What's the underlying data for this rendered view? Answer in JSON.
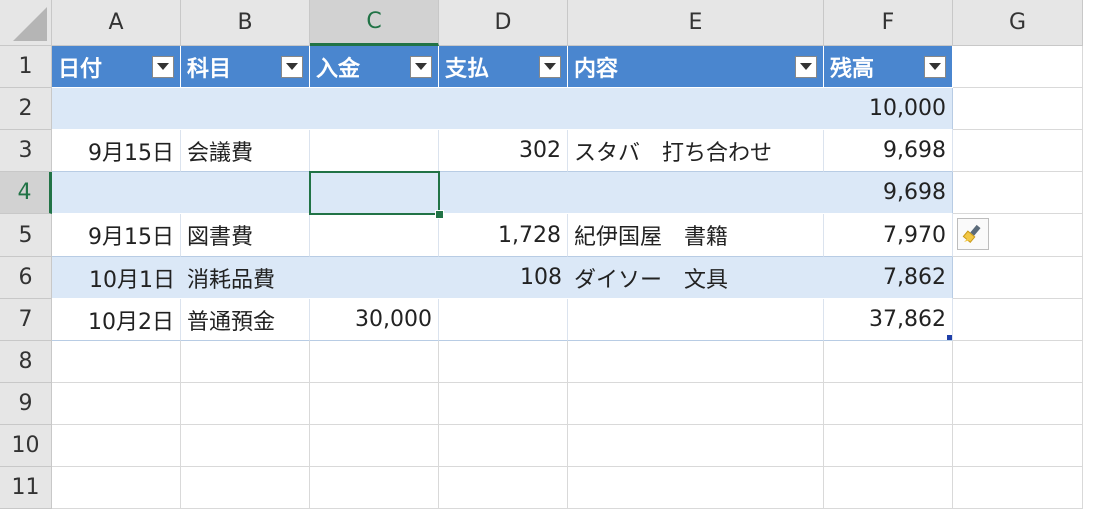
{
  "columns": [
    "A",
    "B",
    "C",
    "D",
    "E",
    "F",
    "G"
  ],
  "rows": [
    "1",
    "2",
    "3",
    "4",
    "5",
    "6",
    "7",
    "8",
    "9",
    "10",
    "11"
  ],
  "selected_column": "C",
  "selected_row": "4",
  "table": {
    "headers": [
      "日付",
      "科目",
      "入金",
      "支払",
      "内容",
      "残高"
    ],
    "data": [
      [
        "",
        "",
        "",
        "",
        "",
        "10,000"
      ],
      [
        "9月15日",
        "会議費",
        "",
        "302",
        "スタバ　打ち合わせ",
        "9,698"
      ],
      [
        "",
        "",
        "",
        "",
        "",
        "9,698"
      ],
      [
        "9月15日",
        "図書費",
        "",
        "1,728",
        "紀伊国屋　書籍",
        "7,970"
      ],
      [
        "10月1日",
        "消耗品費",
        "",
        "108",
        "ダイソー　文具",
        "7,862"
      ],
      [
        "10月2日",
        "普通預金",
        "30,000",
        "",
        "",
        "37,862"
      ]
    ]
  },
  "active_cell": "C4",
  "icons": {
    "filter_dropdown": "dropdown-arrow-icon",
    "quick_analysis": "paintbrush-icon"
  },
  "colors": {
    "header_fill": "#4a86cf",
    "band_fill": "#dbe8f7",
    "selection": "#217346"
  }
}
